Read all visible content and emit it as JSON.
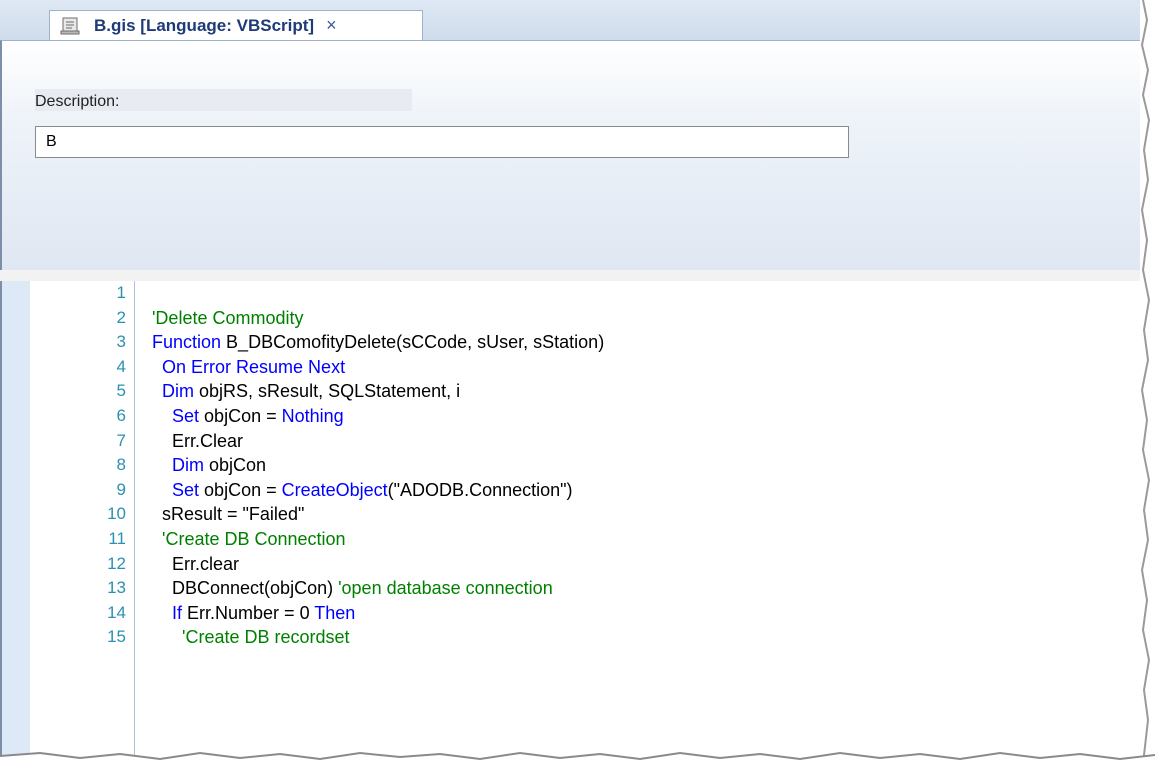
{
  "tab": {
    "title": "B.gis [Language: VBScript]",
    "close_glyph": "×",
    "icon": "script-document-icon"
  },
  "description": {
    "label": "Description:",
    "value": "B"
  },
  "editor": {
    "line_numbers": [
      "1",
      "2",
      "3",
      "4",
      "5",
      "6",
      "7",
      "8",
      "9",
      "10",
      "11",
      "12",
      "13",
      "14",
      "15"
    ],
    "lines": [
      [],
      [
        {
          "t": "'Delete Commodity",
          "c": "cm"
        }
      ],
      [
        {
          "t": "Function",
          "c": "kw"
        },
        {
          "t": " B_DBComofityDelete(sCCode, sUser, sStation)"
        }
      ],
      [
        {
          "t": "  "
        },
        {
          "t": "On Error Resume Next",
          "c": "kw"
        }
      ],
      [
        {
          "t": "  "
        },
        {
          "t": "Dim",
          "c": "kw"
        },
        {
          "t": " objRS, sResult, SQLStatement, i"
        }
      ],
      [
        {
          "t": "    "
        },
        {
          "t": "Set",
          "c": "kw"
        },
        {
          "t": " objCon = "
        },
        {
          "t": "Nothing",
          "c": "kw"
        }
      ],
      [
        {
          "t": "    Err.Clear"
        }
      ],
      [
        {
          "t": "    "
        },
        {
          "t": "Dim",
          "c": "kw"
        },
        {
          "t": " objCon"
        }
      ],
      [
        {
          "t": "    "
        },
        {
          "t": "Set",
          "c": "kw"
        },
        {
          "t": " objCon = "
        },
        {
          "t": "CreateObject",
          "c": "kw"
        },
        {
          "t": "(\"ADODB.Connection\")"
        }
      ],
      [
        {
          "t": "  sResult = \"Failed\""
        }
      ],
      [
        {
          "t": "  "
        },
        {
          "t": "'Create DB Connection",
          "c": "cm"
        }
      ],
      [
        {
          "t": "    Err.clear"
        }
      ],
      [
        {
          "t": "    DBConnect(objCon) "
        },
        {
          "t": "'open database connection",
          "c": "cm"
        }
      ],
      [
        {
          "t": "    "
        },
        {
          "t": "If",
          "c": "kw"
        },
        {
          "t": " Err.Number = 0 "
        },
        {
          "t": "Then",
          "c": "kw"
        }
      ],
      [
        {
          "t": "      "
        },
        {
          "t": "'Create DB recordset",
          "c": "cm"
        }
      ]
    ]
  },
  "colors": {
    "keyword": "#0000ff",
    "comment": "#008000",
    "line_number": "#2b91af"
  }
}
